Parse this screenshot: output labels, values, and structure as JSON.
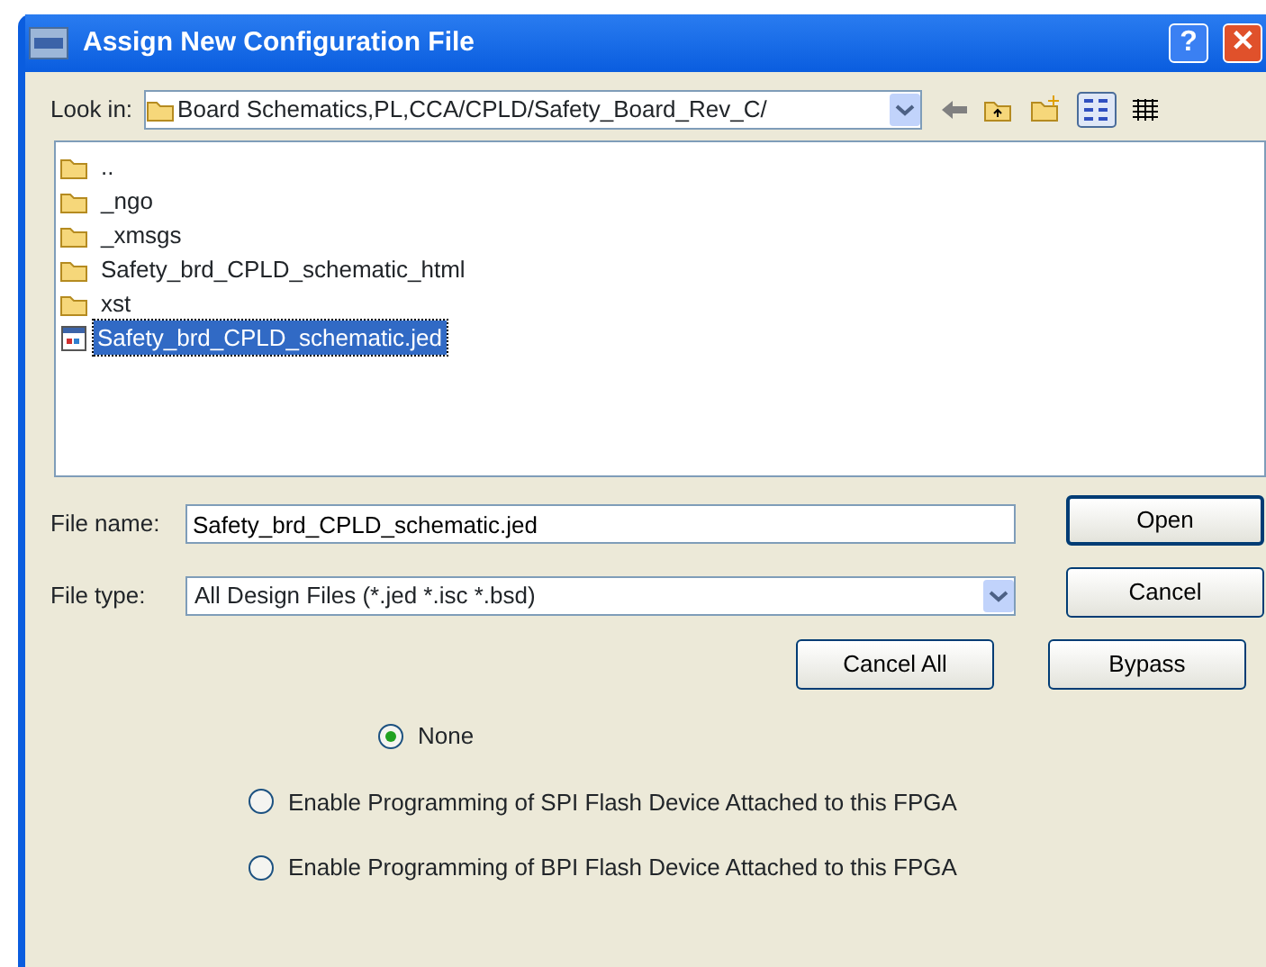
{
  "window": {
    "title": "Assign New Configuration File",
    "help": "?",
    "close": "✕"
  },
  "look_in": {
    "label": "Look in:",
    "value": "Board Schematics,PL,CCA/CPLD/Safety_Board_Rev_C/"
  },
  "files": [
    {
      "name": "..",
      "kind": "folder",
      "selected": false
    },
    {
      "name": "_ngo",
      "kind": "folder",
      "selected": false
    },
    {
      "name": "_xmsgs",
      "kind": "folder",
      "selected": false
    },
    {
      "name": "Safety_brd_CPLD_schematic_html",
      "kind": "folder",
      "selected": false
    },
    {
      "name": "xst",
      "kind": "folder",
      "selected": false
    },
    {
      "name": "Safety_brd_CPLD_schematic.jed",
      "kind": "file",
      "selected": true
    }
  ],
  "file_name": {
    "label": "File name:",
    "value": "Safety_brd_CPLD_schematic.jed"
  },
  "file_type": {
    "label": "File type:",
    "value": "All Design Files (*.jed *.isc *.bsd)"
  },
  "buttons": [
    "Open",
    "Cancel",
    "Cancel All",
    "Bypass"
  ],
  "options": [
    {
      "label": "None",
      "selected": true
    },
    {
      "label": "Enable Programming of SPI Flash Device Attached to this FPGA",
      "selected": false
    },
    {
      "label": "Enable Programming of BPI Flash Device Attached to this FPGA",
      "selected": false
    }
  ]
}
